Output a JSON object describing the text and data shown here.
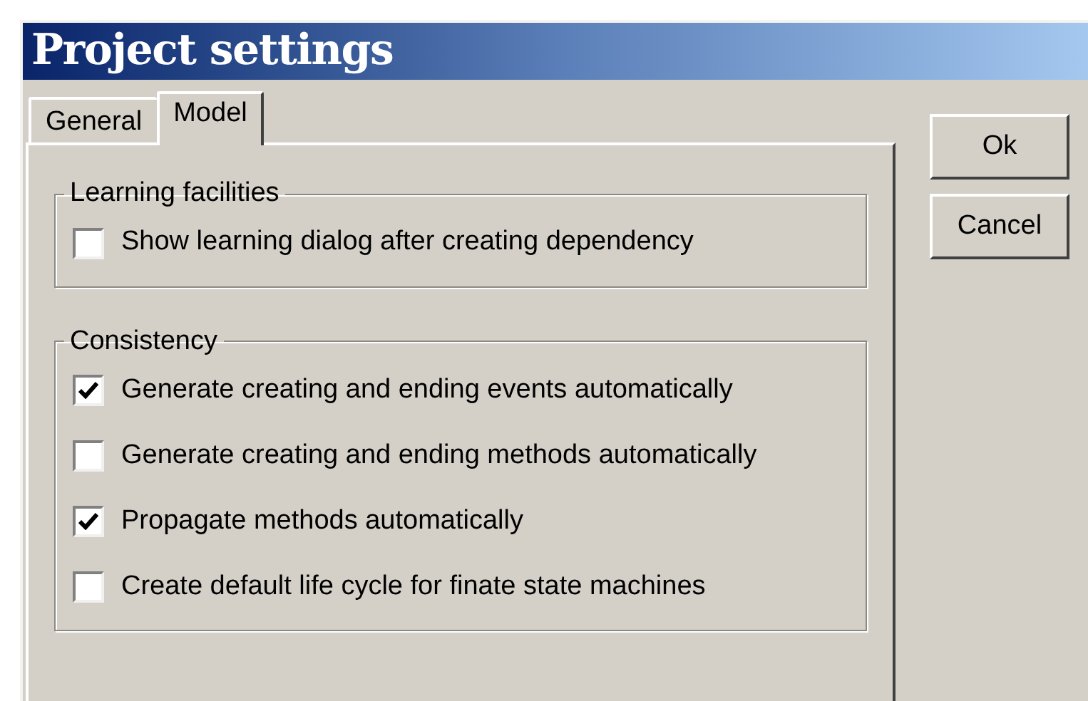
{
  "window": {
    "title": "Project settings"
  },
  "tabs": [
    {
      "label": "General",
      "selected": false
    },
    {
      "label": "Model",
      "selected": true
    }
  ],
  "groups": [
    {
      "title": "Learning facilities",
      "options": [
        {
          "label": "Show learning dialog after creating dependency",
          "checked": false
        }
      ]
    },
    {
      "title": "Consistency",
      "options": [
        {
          "label": "Generate creating and ending events automatically",
          "checked": true
        },
        {
          "label": "Generate creating and ending methods automatically",
          "checked": false
        },
        {
          "label": "Propagate methods automatically",
          "checked": true
        },
        {
          "label": "Create default life cycle for finate state machines",
          "checked": false
        }
      ]
    }
  ],
  "buttons": [
    "Ok",
    "Cancel"
  ]
}
